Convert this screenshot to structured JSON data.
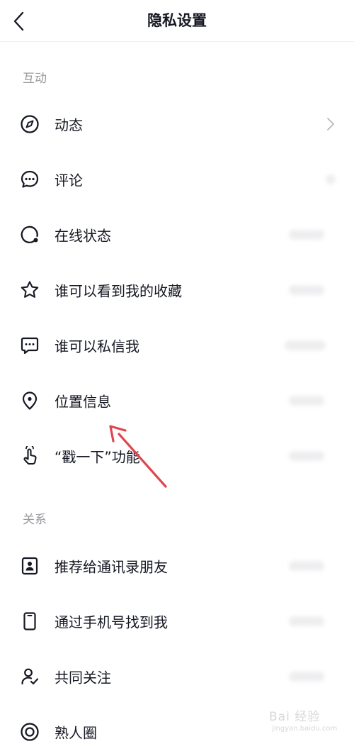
{
  "header": {
    "title": "隐私设置"
  },
  "sections": [
    {
      "label": "互动",
      "items": [
        {
          "label": "动态",
          "icon": "compass-icon"
        },
        {
          "label": "评论",
          "icon": "comment-icon"
        },
        {
          "label": "在线状态",
          "icon": "online-status-icon"
        },
        {
          "label": "谁可以看到我的收藏",
          "icon": "star-icon"
        },
        {
          "label": "谁可以私信我",
          "icon": "message-icon"
        },
        {
          "label": "位置信息",
          "icon": "location-pin-icon"
        },
        {
          "label": "“戳一下”功能",
          "icon": "poke-hand-icon"
        }
      ]
    },
    {
      "label": "关系",
      "items": [
        {
          "label": "推荐给通讯录朋友",
          "icon": "contact-card-icon"
        },
        {
          "label": "通过手机号找到我",
          "icon": "phone-icon"
        },
        {
          "label": "共同关注",
          "icon": "mutual-follow-icon"
        },
        {
          "label": "熟人圈",
          "icon": "circle-icon"
        }
      ]
    }
  ],
  "watermark": {
    "main": "Bai 经验",
    "sub": "jingyan.baidu.com"
  },
  "colors": {
    "text": "#161823",
    "section": "#9a9aa0",
    "annotation_arrow": "#e0464f"
  }
}
